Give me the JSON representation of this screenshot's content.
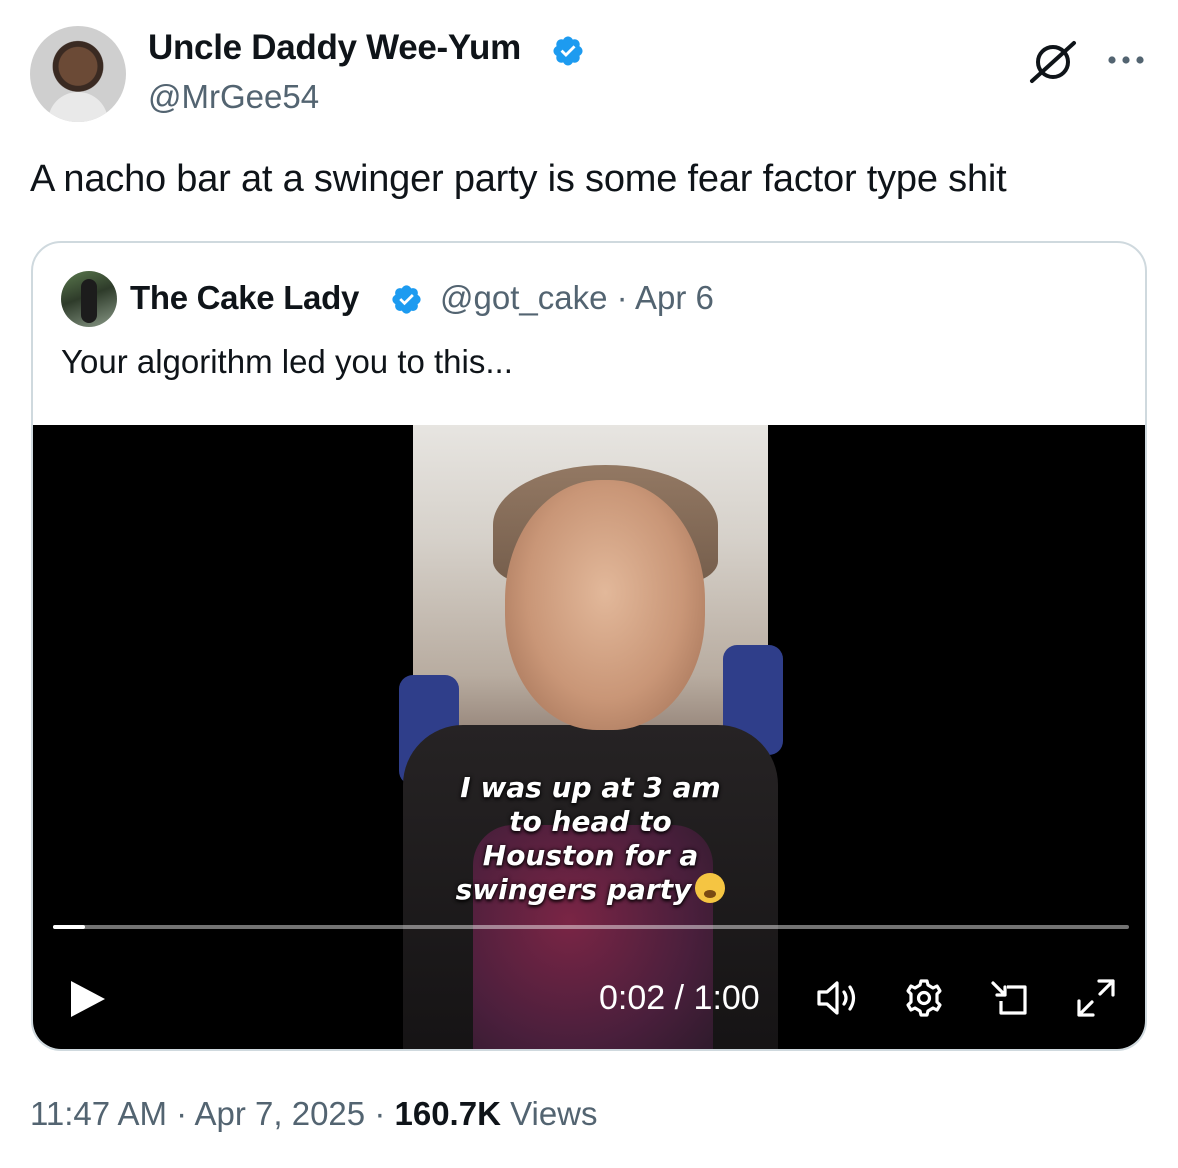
{
  "author": {
    "display_name": "Uncle Daddy Wee-Yum",
    "handle": "@MrGee54",
    "verified": true
  },
  "tweet": {
    "text": "A nacho bar at a swinger party is some fear factor type shit"
  },
  "quoted_tweet": {
    "display_name": "The Cake Lady",
    "handle": "@got_cake",
    "separator": "·",
    "date": "Apr 6",
    "text": "Your algorithm led you to this...",
    "verified": true
  },
  "video": {
    "caption_lines": [
      "I was up at 3 am",
      "to head to",
      "Houston for a",
      "swingers party"
    ],
    "current_time": "0:02",
    "time_separator": "/",
    "duration": "1:00",
    "progress_fraction": 0.03
  },
  "meta": {
    "time": "11:47 AM",
    "separator": "·",
    "date": "Apr 7, 2025",
    "views_count": "160.7K",
    "views_label": "Views"
  },
  "colors": {
    "verified_blue": "#1d9bf0",
    "secondary_text": "#536471",
    "primary_text": "#0f1419",
    "border": "#cfd9de"
  },
  "icons": {
    "verified": "verified-badge-icon",
    "grok": "grok-icon",
    "more": "more-dots-icon",
    "play": "play-icon",
    "volume": "volume-icon",
    "settings": "settings-gear-icon",
    "dock": "picture-in-picture-icon",
    "fullscreen": "fullscreen-expand-icon"
  }
}
